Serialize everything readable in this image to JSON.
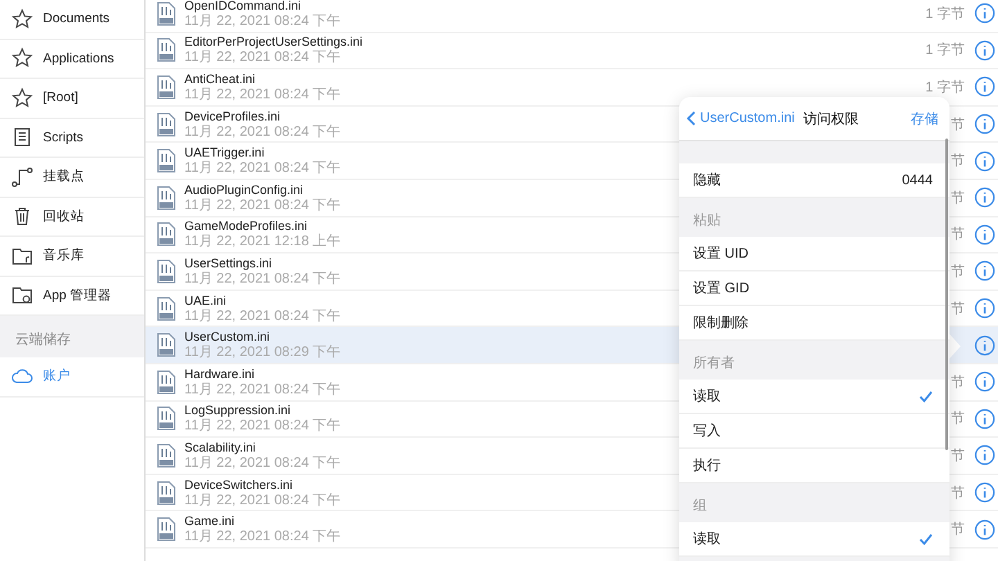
{
  "sidebar": {
    "items": [
      {
        "label": "Documents"
      },
      {
        "label": "Applications"
      },
      {
        "label": "[Root]"
      },
      {
        "label": "Scripts"
      },
      {
        "label": "挂载点"
      },
      {
        "label": "回收站"
      },
      {
        "label": "音乐库"
      },
      {
        "label": "App 管理器"
      }
    ],
    "section": "云端储存",
    "section_items": [
      {
        "label": "账户"
      }
    ]
  },
  "files": [
    {
      "name": "OpenIDCommand.ini",
      "date": "11月 22, 2021 08:24 下午",
      "size": "1 字节",
      "selected": false
    },
    {
      "name": "EditorPerProjectUserSettings.ini",
      "date": "11月 22, 2021 08:24 下午",
      "size": "1 字节",
      "selected": false
    },
    {
      "name": "AntiCheat.ini",
      "date": "11月 22, 2021 08:24 下午",
      "size": "1 字节",
      "selected": false
    },
    {
      "name": "DeviceProfiles.ini",
      "date": "11月 22, 2021 08:24 下午",
      "size": "节",
      "selected": false
    },
    {
      "name": "UAETrigger.ini",
      "date": "11月 22, 2021 08:24 下午",
      "size": "节",
      "selected": false
    },
    {
      "name": "AudioPluginConfig.ini",
      "date": "11月 22, 2021 08:24 下午",
      "size": "节",
      "selected": false
    },
    {
      "name": "GameModeProfiles.ini",
      "date": "11月 22, 2021 12:18 上午",
      "size": "节",
      "selected": false
    },
    {
      "name": "UserSettings.ini",
      "date": "11月 22, 2021 08:24 下午",
      "size": "节",
      "selected": false
    },
    {
      "name": "UAE.ini",
      "date": "11月 22, 2021 08:24 下午",
      "size": "节",
      "selected": false
    },
    {
      "name": "UserCustom.ini",
      "date": "11月 22, 2021 08:29 下午",
      "selected": true
    },
    {
      "name": "Hardware.ini",
      "date": "11月 22, 2021 08:24 下午",
      "size": "节",
      "selected": false
    },
    {
      "name": "LogSuppression.ini",
      "date": "11月 22, 2021 08:24 下午",
      "size": "节",
      "selected": false
    },
    {
      "name": "Scalability.ini",
      "date": "11月 22, 2021 08:24 下午",
      "size": "节",
      "selected": false
    },
    {
      "name": "DeviceSwitchers.ini",
      "date": "11月 22, 2021 08:24 下午",
      "size": "节",
      "selected": false
    },
    {
      "name": "Game.ini",
      "date": "11月 22, 2021 08:24 下午",
      "size": "节",
      "selected": false
    }
  ],
  "popover": {
    "back": "UserCustom.ini",
    "title": "访问权限",
    "save": "存储",
    "sections": [
      {
        "rows": [
          {
            "kind": "value",
            "label": "隐藏",
            "value": "0444"
          }
        ]
      },
      {
        "header": "粘贴",
        "rows": [
          {
            "kind": "action",
            "label": "设置 UID"
          },
          {
            "kind": "action",
            "label": "设置 GID"
          },
          {
            "kind": "action",
            "label": "限制删除"
          }
        ]
      },
      {
        "header": "所有者",
        "rows": [
          {
            "kind": "check",
            "label": "读取",
            "checked": true
          },
          {
            "kind": "check",
            "label": "写入",
            "checked": false
          },
          {
            "kind": "check",
            "label": "执行",
            "checked": false
          }
        ]
      },
      {
        "header": "组",
        "rows": [
          {
            "kind": "check",
            "label": "读取",
            "checked": true
          }
        ]
      }
    ]
  }
}
